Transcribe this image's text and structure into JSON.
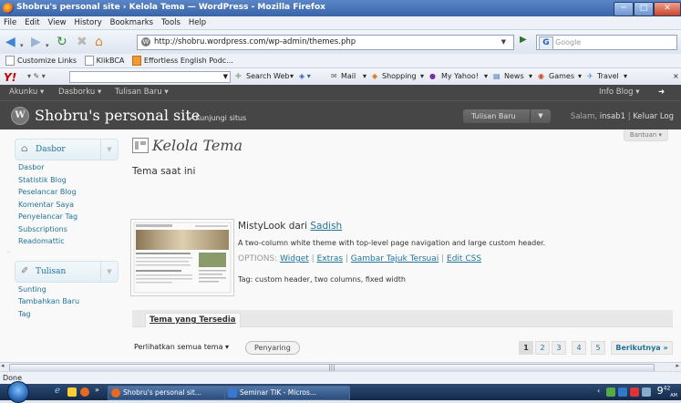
{
  "window": {
    "title": "Shobru's personal site › Kelola Tema — WordPress - Mozilla Firefox",
    "buttons": [
      "─",
      "□",
      "✕"
    ]
  },
  "menubar": [
    "File",
    "Edit",
    "View",
    "History",
    "Bookmarks",
    "Tools",
    "Help"
  ],
  "nav": {
    "url": "http://shobru.wordpress.com/wp-admin/themes.php",
    "search_placeholder": "Google"
  },
  "bookmarks": [
    "Customize Links",
    "KlikBCA",
    "Effortless English Podc..."
  ],
  "yahoo": {
    "search_web": "Search Web",
    "items": [
      "Mail",
      "Shopping",
      "My Yahoo!",
      "News",
      "Games",
      "Travel"
    ]
  },
  "wp_adminbar": {
    "left": [
      "Akunku",
      "Dasborku",
      "Tulisan Baru"
    ],
    "right": "Info Blog"
  },
  "wp_header": {
    "site_title": "Shobru's personal site",
    "visit_site": "← Kunjungi situs",
    "new_post": "Tulisan Baru",
    "greeting_prefix": "Salam,",
    "username": "insab1",
    "logout": "Keluar Log"
  },
  "sidebar": {
    "dasbor": {
      "label": "Dasbor",
      "items": [
        "Dasbor",
        "Statistik Blog",
        "Peselancar Blog",
        "Komentar Saya",
        "Penyelancar Tag",
        "Subscriptions",
        "Readomattic"
      ]
    },
    "tulisan": {
      "label": "Tulisan",
      "items": [
        "Sunting",
        "Tambahkan Baru",
        "Tag"
      ]
    }
  },
  "main": {
    "help": "Bantuan",
    "page_title": "Kelola Tema",
    "current_theme_heading": "Tema saat ini",
    "theme_name": "MistyLook dari",
    "theme_author": "Sadish",
    "theme_description": "A two-column white theme with top-level page navigation and large custom header.",
    "options_label": "OPTIONS:",
    "options": [
      "Widget",
      "Extras",
      "Gambar Tajuk Tersuai",
      "Edit CSS"
    ],
    "tags": "Tag: custom header, two columns, fixed width",
    "available_tab": "Tema yang Tersedia",
    "show_all": "Perlihatkan semua tema",
    "filter_button": "Penyaring",
    "pages": [
      "1",
      "2",
      "3",
      "4",
      "5"
    ],
    "next": "Berikutnya »"
  },
  "statusbar": "Done",
  "taskbar": {
    "tasks": [
      "Shobru's personal sit...",
      "Seminar TIK - Micros..."
    ],
    "time": "9",
    "time_sup": "42",
    "time_ampm": "AM"
  }
}
